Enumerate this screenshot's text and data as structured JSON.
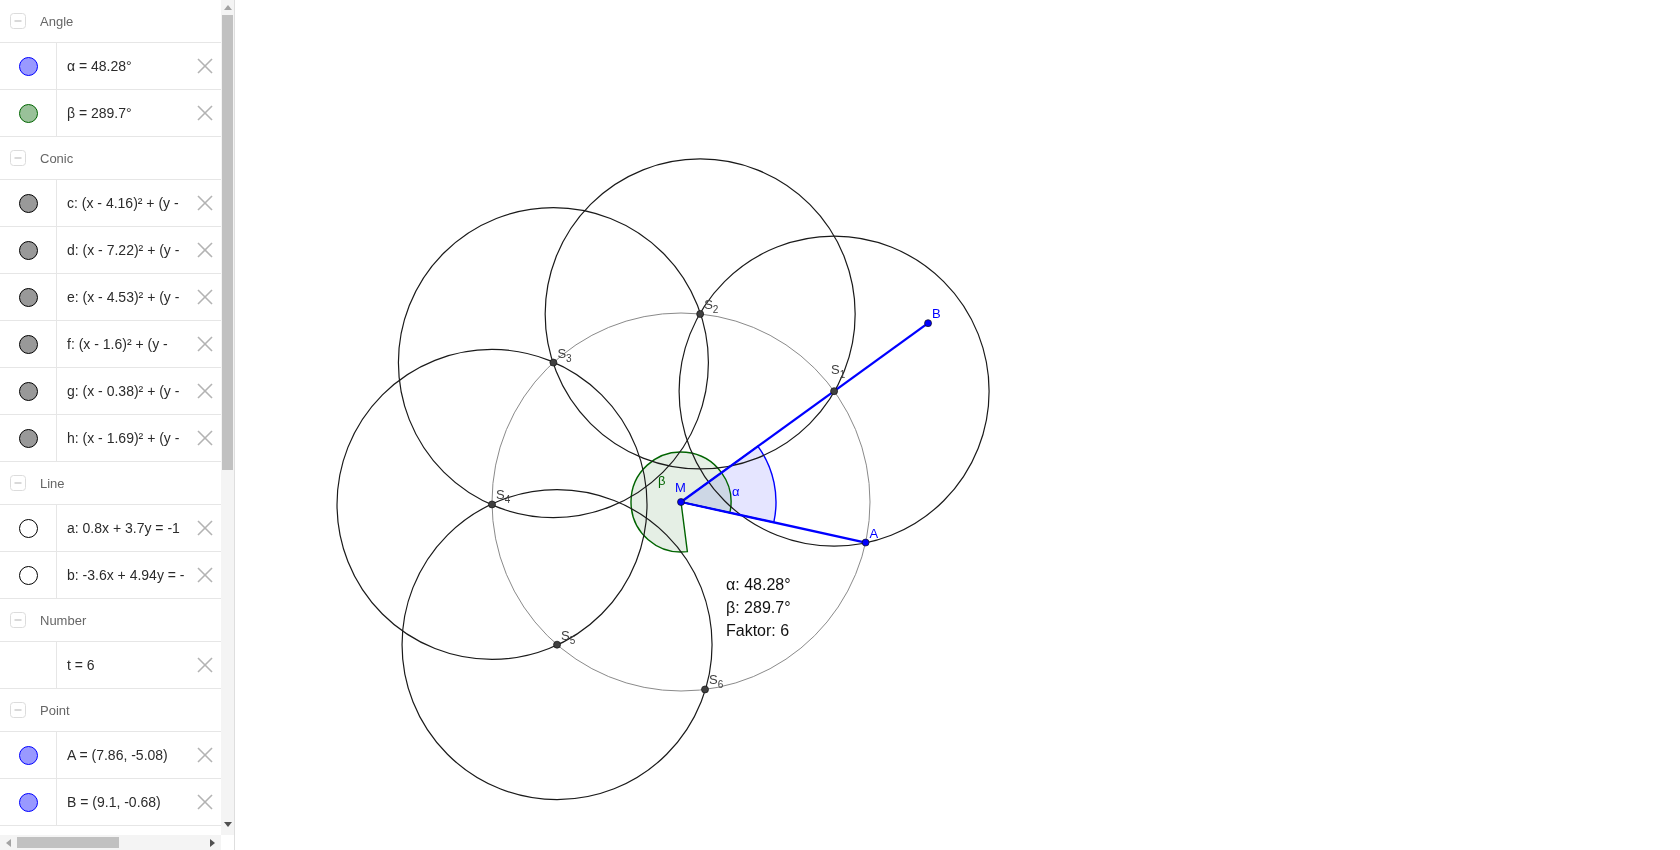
{
  "algebra_view": {
    "groups": [
      {
        "title": "Angle",
        "expanded": true,
        "items": [
          {
            "text": "α = 48.28°",
            "dot": {
              "visible": true,
              "color": "#9999ff"
            }
          },
          {
            "text": "β = 289.7°",
            "dot": {
              "visible": true,
              "color": "#99c199"
            }
          }
        ]
      },
      {
        "title": "Conic",
        "expanded": true,
        "items": [
          {
            "text": "c: (x - 4.16)² + (y -",
            "dot": {
              "visible": true,
              "color": "#999999"
            }
          },
          {
            "text": "d: (x - 7.22)² + (y -",
            "dot": {
              "visible": true,
              "color": "#999999"
            }
          },
          {
            "text": "e: (x - 4.53)² + (y -",
            "dot": {
              "visible": true,
              "color": "#999999"
            }
          },
          {
            "text": "f: (x - 1.6)² + (y -",
            "dot": {
              "visible": true,
              "color": "#999999"
            }
          },
          {
            "text": "g: (x - 0.38)² + (y -",
            "dot": {
              "visible": true,
              "color": "#999999"
            }
          },
          {
            "text": "h: (x - 1.69)² + (y -",
            "dot": {
              "visible": true,
              "color": "#999999"
            }
          }
        ]
      },
      {
        "title": "Line",
        "expanded": true,
        "items": [
          {
            "text": "a: 0.8x + 3.7y = -1",
            "dot": {
              "visible": false
            }
          },
          {
            "text": "b: -3.6x + 4.94y = -",
            "dot": {
              "visible": false
            }
          }
        ]
      },
      {
        "title": "Number",
        "expanded": true,
        "items": [
          {
            "text": "t = 6"
          }
        ]
      },
      {
        "title": "Point",
        "expanded": true,
        "items": [
          {
            "text": "A = (7.86, -5.08)",
            "dot": {
              "visible": true,
              "color": "#9999ff"
            }
          },
          {
            "text": "B = (9.1, -0.68)",
            "dot": {
              "visible": true,
              "color": "#9999ff"
            }
          }
        ]
      }
    ]
  },
  "graphics": {
    "points": [
      {
        "label": "M",
        "color": "#0000ff"
      },
      {
        "label": "A",
        "color": "#0000ff"
      },
      {
        "label": "B",
        "color": "#0000ff"
      },
      {
        "label": "S$_{1}$",
        "color": "#404040"
      },
      {
        "label": "S$_{2}$",
        "color": "#404040"
      },
      {
        "label": "S$_{3}$",
        "color": "#404040"
      },
      {
        "label": "S$_{4}$",
        "color": "#404040"
      },
      {
        "label": "S$_{5}$",
        "color": "#404040"
      },
      {
        "label": "S$_{6}$",
        "color": "#404040"
      }
    ],
    "angles": [
      {
        "label": "α",
        "color": "#0000ff"
      },
      {
        "label": "β",
        "color": "#006400"
      }
    ],
    "info_text": [
      "α: 48.28°",
      "β: 289.7°",
      "Faktor: 6"
    ]
  }
}
